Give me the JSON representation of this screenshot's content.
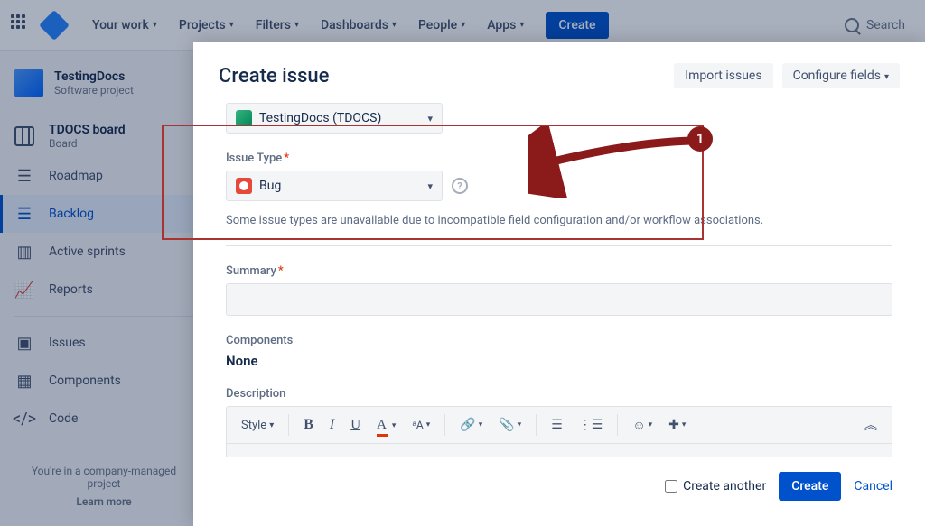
{
  "topnav": {
    "items": [
      "Your work",
      "Projects",
      "Filters",
      "Dashboards",
      "People",
      "Apps"
    ],
    "create": "Create",
    "search_placeholder": "Search"
  },
  "sidebar": {
    "project_name": "TestingDocs",
    "project_type": "Software project",
    "board_name": "TDOCS board",
    "board_sub": "Board",
    "items": [
      {
        "label": "Roadmap"
      },
      {
        "label": "Backlog"
      },
      {
        "label": "Active sprints"
      },
      {
        "label": "Reports"
      },
      {
        "label": "Issues"
      },
      {
        "label": "Components"
      },
      {
        "label": "Code"
      }
    ],
    "footer_text": "You're in a company-managed project",
    "learn_more": "Learn more"
  },
  "modal": {
    "title": "Create issue",
    "import": "Import issues",
    "configure": "Configure fields",
    "project_value": "TestingDocs (TDOCS)",
    "issue_type_label": "Issue Type",
    "issue_type_value": "Bug",
    "issue_type_helper": "Some issue types are unavailable due to incompatible field configuration and/or workflow associations.",
    "summary_label": "Summary",
    "components_label": "Components",
    "components_value": "None",
    "description_label": "Description",
    "style_label": "Style",
    "create_another": "Create another",
    "create_btn": "Create",
    "cancel": "Cancel"
  },
  "annotation": {
    "badge": "1"
  }
}
